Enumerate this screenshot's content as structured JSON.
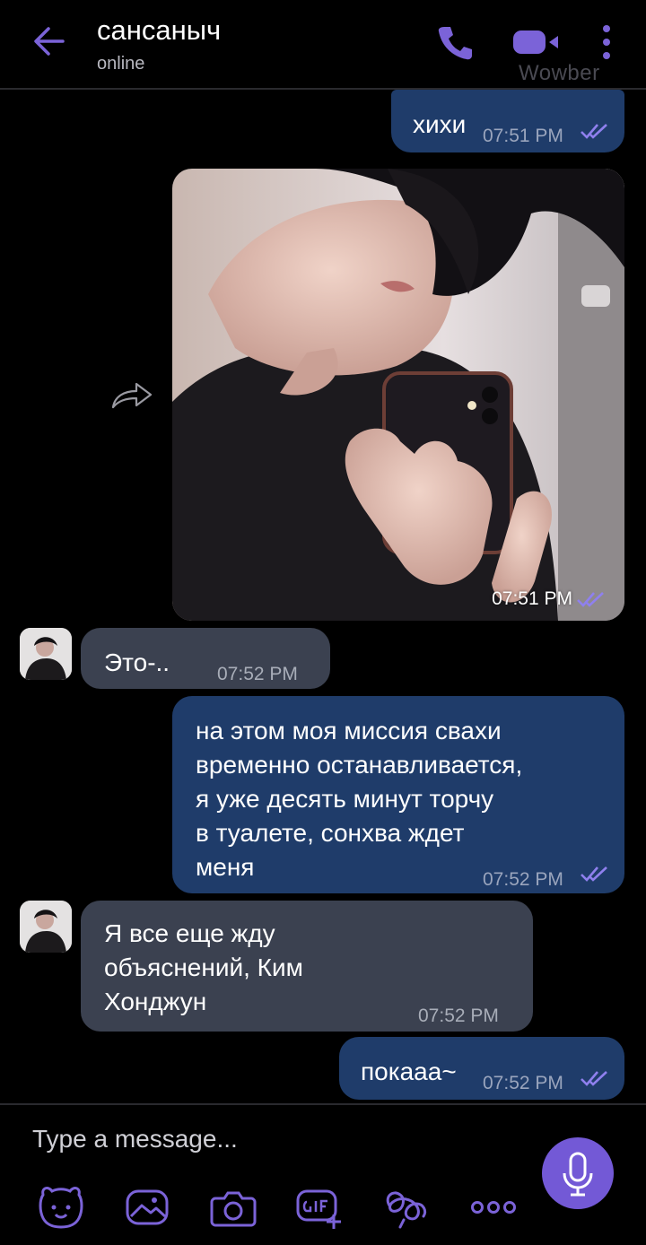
{
  "header": {
    "contact_name": "сансаныч",
    "status": "online",
    "watermark": "Wowber"
  },
  "messages": [
    {
      "direction": "out",
      "text": "хихи",
      "time": "07:51 PM",
      "read": true
    },
    {
      "direction": "out",
      "type": "photo",
      "time": "07:51 PM",
      "read": true
    },
    {
      "direction": "in",
      "text": "Это-..",
      "time": "07:52 PM"
    },
    {
      "direction": "out",
      "text": "на этом моя миссия свахи\nвременно останавливается,\nя уже десять минут торчу\nв туалете, сонхва ждет\nменя",
      "time": "07:52 PM",
      "read": true
    },
    {
      "direction": "in",
      "text": "Я все еще жду\nобъяснений, Ким\nХонджун",
      "time": "07:52 PM"
    },
    {
      "direction": "out",
      "text": "покааа~",
      "time": "07:52 PM",
      "read": true
    }
  ],
  "composer": {
    "placeholder": "Type a message...",
    "tools": [
      "sticker-icon",
      "gallery-icon",
      "camera-icon",
      "gif-icon",
      "doodle-icon",
      "more-options-icon"
    ]
  },
  "colors": {
    "accent": "#7359d6",
    "outgoing_bubble": "#1f3c6a",
    "incoming_bubble": "#3b4150",
    "background": "#000000"
  }
}
